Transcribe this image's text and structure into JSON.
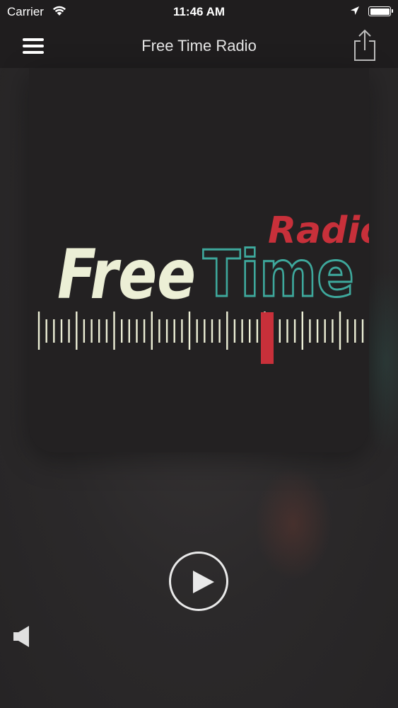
{
  "status_bar": {
    "carrier": "Carrier",
    "time": "11:46 AM",
    "icons": [
      "wifi-icon",
      "location-arrow-icon",
      "battery-icon"
    ]
  },
  "nav_bar": {
    "title": "Free Time Radio",
    "menu_icon": "hamburger-menu-icon",
    "share_icon": "share-icon"
  },
  "artwork": {
    "logo_text_free": "Free",
    "logo_text_time": "Time",
    "logo_text_radio": "Radio"
  },
  "player": {
    "play_icon": "play-icon",
    "volume_icon": "speaker-icon"
  },
  "colors": {
    "free_text": "#ecefd6",
    "time_text": "#3ea89c",
    "radio_text": "#c8303a",
    "dial_indicator": "#c8303a",
    "bars": "#1f1d1e"
  }
}
